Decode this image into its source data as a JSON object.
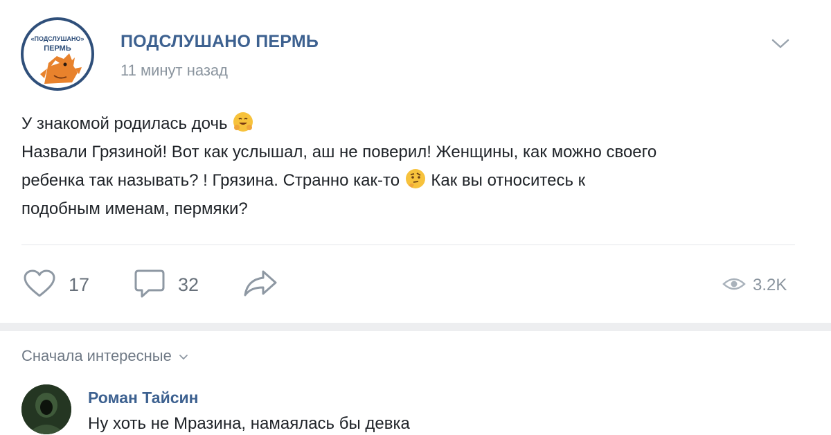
{
  "post": {
    "group_name": "ПОДСЛУШАНО ПЕРМЬ",
    "time": "11 минут назад",
    "avatar_text_top": "«ПОДСЛУШАНО»",
    "avatar_text_bottom": "ПЕРМЬ",
    "line1": "У знакомой родилась дочь",
    "line2": "Назвали Грязиной! Вот как услышал, аш не поверил! Женщины, как можно своего",
    "line3a": "ребенка так называть? ! Грязина. Странно как-то",
    "line3b": "Как вы относитесь к",
    "line4": "подобным именам, пермяки?",
    "emoji1": "hugging-face-icon",
    "emoji2": "thinking-face-icon"
  },
  "actions": {
    "likes": "17",
    "comments": "32",
    "views": "3.2K"
  },
  "comments_section": {
    "sort_label": "Сначала интересные",
    "comment": {
      "author": "Роман Тайсин",
      "text": "Ну хоть не Мразина, намаялась бы девка"
    }
  },
  "colors": {
    "accent": "#3d6190",
    "text": "#1f2328",
    "muted": "#8a949e",
    "separator": "#edeef0"
  }
}
